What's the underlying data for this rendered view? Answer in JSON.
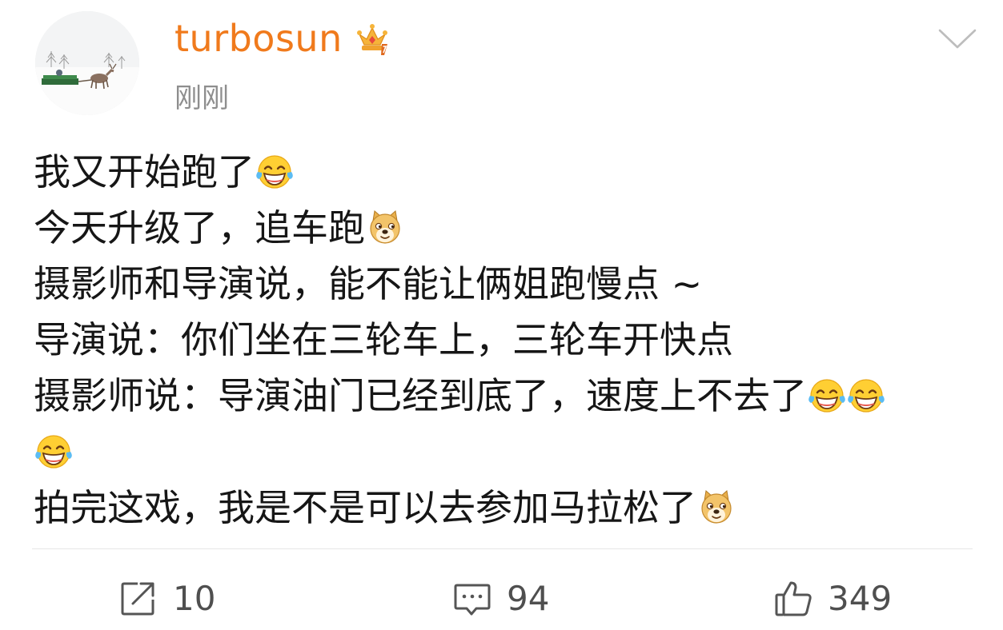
{
  "post": {
    "author": {
      "username": "turbosun",
      "badge_icon": "vip-crown-icon"
    },
    "timestamp": "刚刚",
    "lines": [
      {
        "segments": [
          "我又开始跑了"
        ],
        "emojis": [
          "laugh-cry"
        ]
      },
      {
        "segments": [
          "今天升级了，追车跑"
        ],
        "emojis": [
          "doge"
        ]
      },
      {
        "segments": [
          "摄影师和导演说，能不能让俩姐跑慢点 ~"
        ],
        "emojis": []
      },
      {
        "segments": [
          "导演说：你们坐在三轮车上，三轮车开快点"
        ],
        "emojis": []
      },
      {
        "segments": [
          "摄影师说：导演油门已经到底了，速度上不去了"
        ],
        "emojis": [
          "laugh-cry",
          "laugh-cry"
        ]
      },
      {
        "segments": [
          ""
        ],
        "emojis": [
          "laugh-cry"
        ]
      },
      {
        "segments": [
          "拍完这戏，我是不是可以去参加马拉松了"
        ],
        "emojis": [
          "doge"
        ]
      }
    ]
  },
  "actions": {
    "repost": {
      "icon": "repost-icon",
      "count": "10"
    },
    "comment": {
      "icon": "comment-icon",
      "count": "94"
    },
    "like": {
      "icon": "thumbs-up-icon",
      "count": "349"
    }
  },
  "colors": {
    "username": "#f07a1c",
    "timestamp": "#8e8e8e",
    "text": "#161616",
    "icon": "#4f4f4f"
  }
}
